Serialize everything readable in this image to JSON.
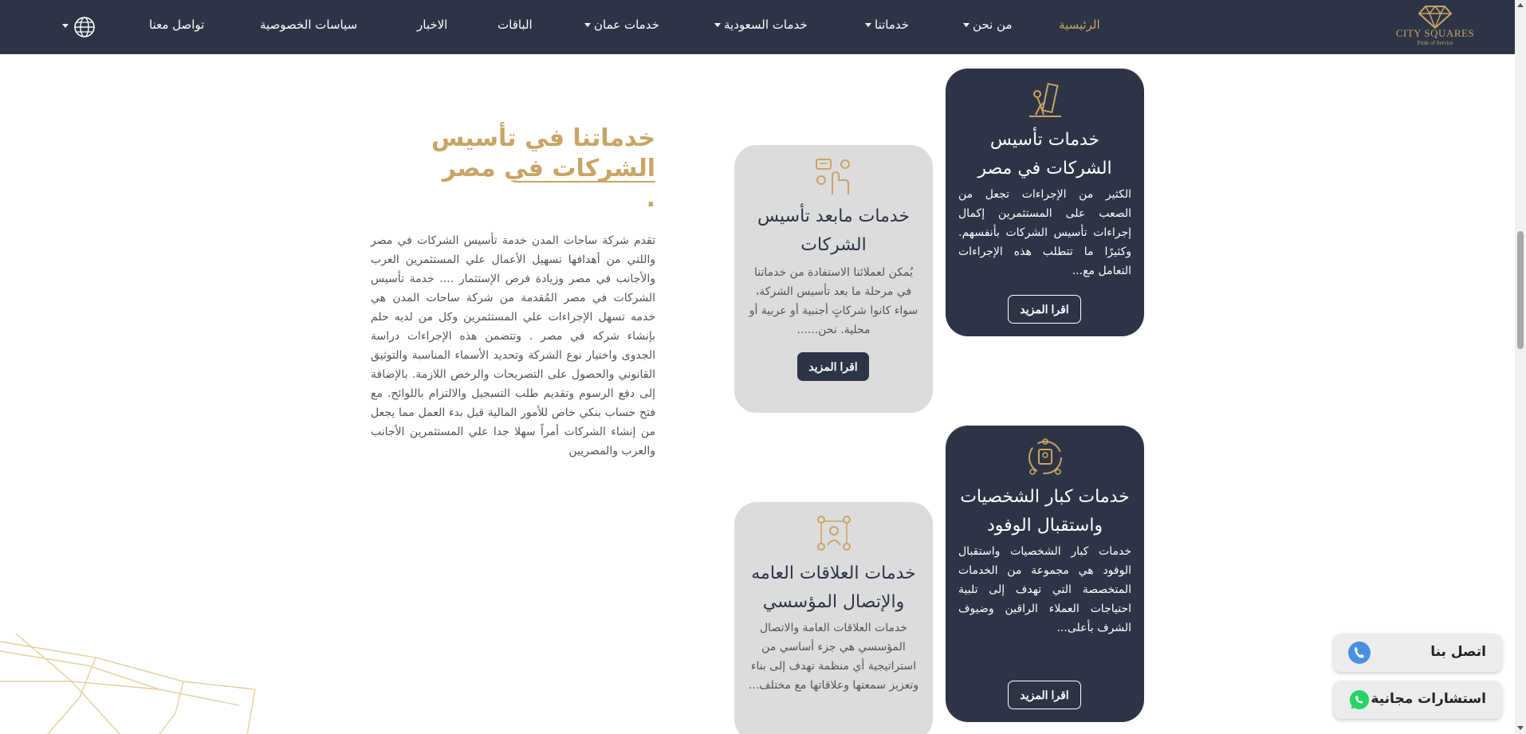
{
  "nav": {
    "logo_brand": "CITY SQUARES",
    "logo_tagline": "Pride of Service",
    "home": "الرئيسية",
    "about": "من نحن",
    "services": "خدماتنا",
    "saudi_services": "خدمات السعودية",
    "oman_services": "خدمات عمان",
    "packages": "الباقات",
    "news": "الاخبار",
    "privacy": "سياسات الخصوصية",
    "contact": "تواصل معنا",
    "accent_color": "#c9a465",
    "background_color": "#2d3446"
  },
  "section": {
    "title_line1": "خدماتنا في تأسيس",
    "title_line2": "الشركات في مصر .",
    "body": "تقدم شركة ساحات المدن خدمة تأسيس الشركات في مصر واللتي من أهدافها تسهيل الأعمال علي المستثمرين العرب والأجانب في مصر وزيادة فرص الإستثمار .... خدمة تأسيس الشركات في مصر المُقدمة من شركة ساحات المدن هي خدمه تسهل الإجراءات علي المستثمرين وكل من لديه حلم بإنشاء شركه في مصر . وتتضمن هذه الإجراءات دراسة الجدوى واختيار نوع الشركة وتحديد الأسماء المناسبة والتوثيق القانوني والحصول على التصريحات والرخص اللازمة. بالإضافة إلى دفع الرسوم وتقديم طلب التسجيل والالتزام باللوائح. مع فتح حساب بنكي خاص للأمور المالية قبل بدء العمل مما يجعل من إنشاء الشركات أمراً سهلا جدا علي المستثمرين الأجانب والعرب والمصريين"
  },
  "cards": [
    {
      "title": "خدمات تأسيس الشركات في مصر",
      "desc": "الكثير من الإجراءات تجعل من الصعب على المستثمرين إكمال إجراءات تأسيس الشركات بأنفسهم. وكثيرًا ما تتطلب هذه الإجراءات التعامل مع...",
      "button": "اقرا المزيد",
      "icon": "worker-pushing-icon"
    },
    {
      "title": "خدمات مابعد تأسيس الشركات",
      "desc": "يُمكن لعملائنا الاستفادة من خدماتنا في مرحلة ما بعد تأسيس الشركة، سواء كانوا شركاتٍ أجنبية أو عربية أو محلية. نحن......",
      "button": "اقرا المزيد",
      "icon": "touch-hand-icon"
    },
    {
      "title": "خدمات كبار الشخصيات واستقبال الوفود",
      "desc": "خدمات كبار الشخصيات واستقبال الوفود هي مجموعة من الخدمات المتخصصة التي تهدف إلى تلبية احتياجات العملاء الراقين وضيوف الشرف بأعلى...",
      "button": "اقرا المزيد",
      "icon": "vip-exchange-icon"
    },
    {
      "title": "خدمات العلاقات العامه والإتصال المؤسسي",
      "desc": "خدمات العلاقات العامة والاتصال المؤسسي هي جزء أساسي من استراتيجية أي منظمة تهدف إلى بناء وتعزيز سمعتها وعلاقاتها مع مختلف...",
      "button": "",
      "icon": "network-people-icon"
    }
  ],
  "floating": {
    "contact_us": "اتصل بنا",
    "free_consult": "استشارات مجانية"
  }
}
